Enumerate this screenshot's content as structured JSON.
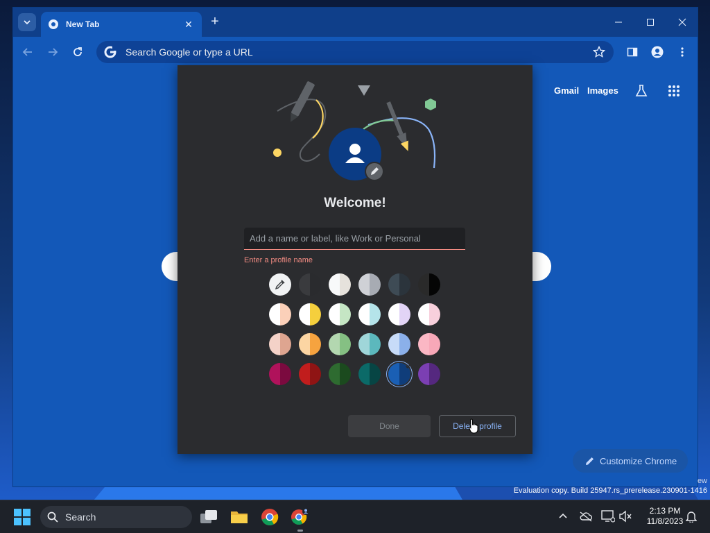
{
  "colors": {
    "accent": "#8ab4f8",
    "error": "#f28b82",
    "window_bg": "#1358b8",
    "dialog_bg": "#2b2c2f"
  },
  "browser": {
    "tab_title": "New Tab",
    "omnibox_placeholder": "Search Google or type a URL"
  },
  "ntp": {
    "gmail": "Gmail",
    "images": "Images",
    "customize": "Customize Chrome"
  },
  "dialog": {
    "title": "Welcome!",
    "name_placeholder": "Add a name or label, like Work or Personal",
    "error_text": "Enter a profile name",
    "done_label": "Done",
    "delete_label": "Delete profile",
    "selected_color_index": 22,
    "swatches": [
      {
        "type": "picker"
      },
      {
        "left": "#3a3b3e",
        "right": "#2a2b2e"
      },
      {
        "left": "#f8f9fa",
        "right": "#e6e2dc"
      },
      {
        "left": "#cfd1d6",
        "right": "#a7abb3"
      },
      {
        "left": "#3e4b55",
        "right": "#2b343c"
      },
      {
        "left": "#2a2a2a",
        "right": "#050505"
      },
      {
        "left": "#ffffff",
        "right": "#fbd0b9"
      },
      {
        "left": "#ffffff",
        "right": "#f5cf3d"
      },
      {
        "left": "#ffffff",
        "right": "#c5e6c4"
      },
      {
        "left": "#ffffff",
        "right": "#b5e4ea"
      },
      {
        "left": "#ffffff",
        "right": "#e2d4f6"
      },
      {
        "left": "#ffffff",
        "right": "#f8d0dc"
      },
      {
        "left": "#f4d2c8",
        "right": "#dea590"
      },
      {
        "left": "#fcd5a3",
        "right": "#f6a33f"
      },
      {
        "left": "#b3d7b0",
        "right": "#85c083"
      },
      {
        "left": "#9fd6d9",
        "right": "#5cb8bd"
      },
      {
        "left": "#c7dbf8",
        "right": "#8bb0ea"
      },
      {
        "left": "#fbb7c4",
        "right": "#f8a8b8"
      },
      {
        "left": "#b0125b",
        "right": "#7b0a3f"
      },
      {
        "left": "#c11d1d",
        "right": "#8f1414"
      },
      {
        "left": "#2e6b30",
        "right": "#1b4a1e"
      },
      {
        "left": "#0b6a68",
        "right": "#074544"
      },
      {
        "left": "#1a5fb4",
        "right": "#0f3d7a"
      },
      {
        "left": "#7b3fb3",
        "right": "#55287f"
      }
    ]
  },
  "watermark": {
    "edge_text": "ew",
    "build_text": "Evaluation copy. Build 25947.rs_prerelease.230901-1416"
  },
  "taskbar": {
    "search_label": "Search",
    "time": "2:13 PM",
    "date": "11/8/2023"
  }
}
